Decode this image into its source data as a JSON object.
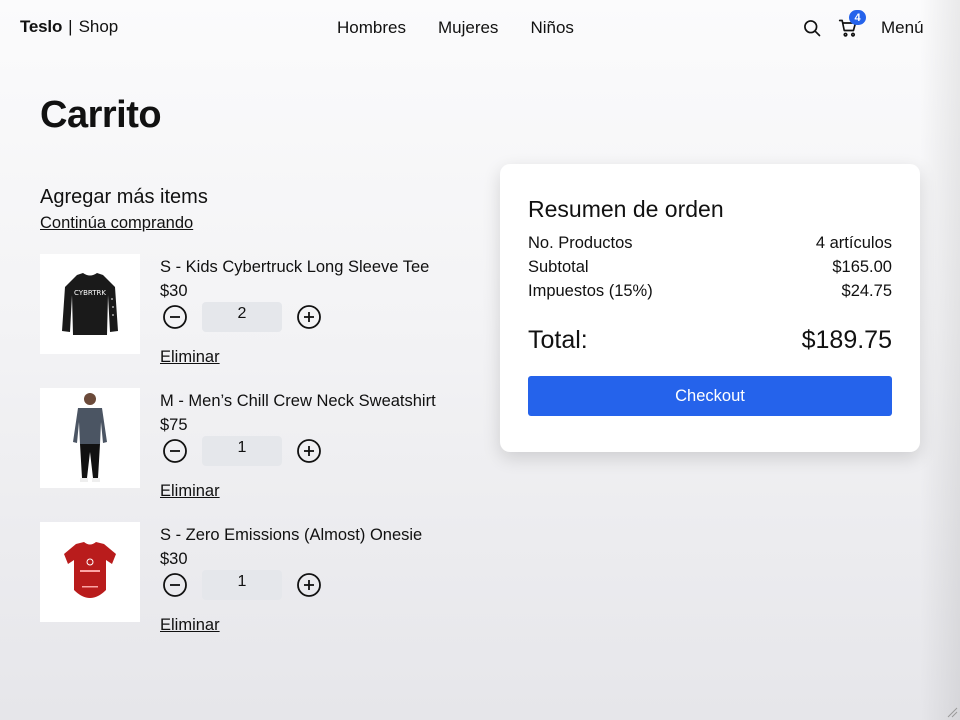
{
  "nav": {
    "brand_strong": "Teslo",
    "brand_sep": "|",
    "brand_light": "Shop",
    "links": [
      "Hombres",
      "Mujeres",
      "Niños"
    ],
    "cart_count": "4",
    "menu_label": "Menú"
  },
  "page": {
    "title": "Carrito",
    "add_more": "Agregar más items",
    "continue_link": "Continúa comprando"
  },
  "cart": {
    "items": [
      {
        "title": "S - Kids Cybertruck Long Sleeve Tee",
        "price": "$30",
        "qty": "2",
        "remove": "Eliminar",
        "image": "black-long-sleeve-tee",
        "image_text": "CYBRTRK"
      },
      {
        "title": "M - Men’s Chill Crew Neck Sweatshirt",
        "price": "$75",
        "qty": "1",
        "remove": "Eliminar",
        "image": "man-gray-sweatshirt"
      },
      {
        "title": "S - Zero Emissions (Almost) Onesie",
        "price": "$30",
        "qty": "1",
        "remove": "Eliminar",
        "image": "red-onesie"
      }
    ]
  },
  "summary": {
    "title": "Resumen de orden",
    "rows": [
      {
        "label": "No. Productos",
        "value": "4 artículos"
      },
      {
        "label": "Subtotal",
        "value": "$165.00"
      },
      {
        "label": "Impuestos (15%)",
        "value": "$24.75"
      }
    ],
    "total_label": "Total:",
    "total_value": "$189.75",
    "checkout_label": "Checkout"
  },
  "colors": {
    "accent": "#2563eb",
    "qty_bg": "#e5e7eb"
  }
}
